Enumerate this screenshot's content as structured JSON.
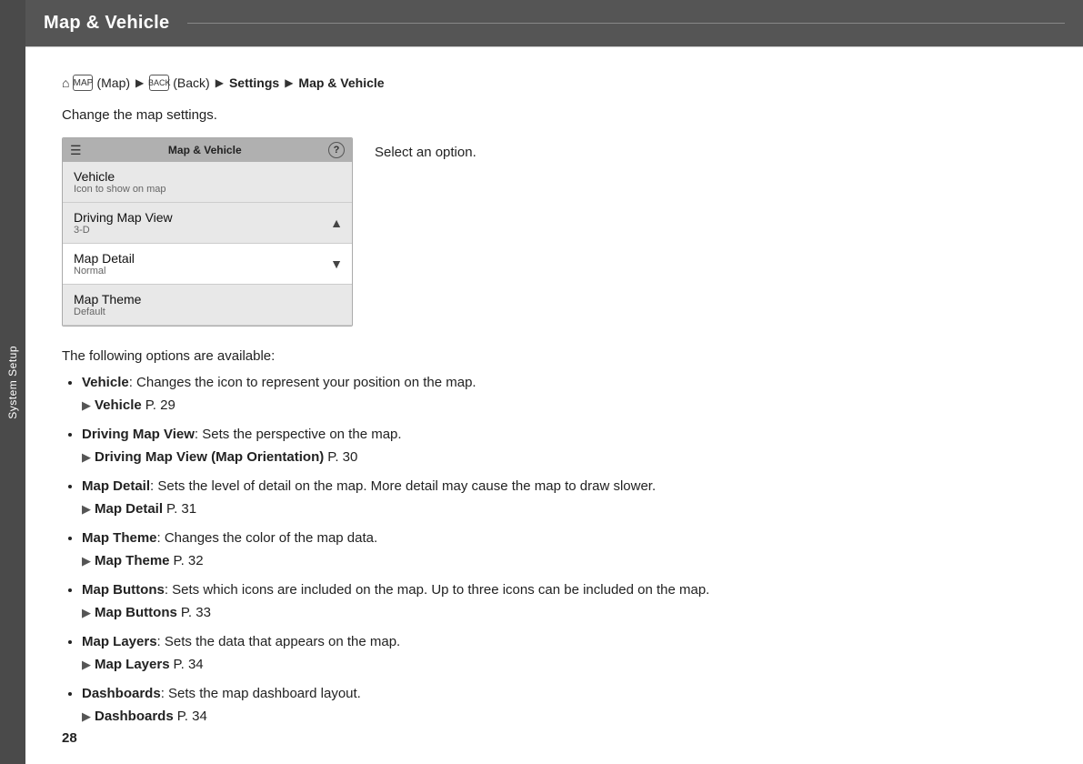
{
  "sidebar": {
    "label": "System Setup"
  },
  "header": {
    "title": "Map & Vehicle"
  },
  "breadcrumb": {
    "home_icon": "⌂",
    "map_icon": "MAP",
    "map_label": "(Map)",
    "back_icon": "BACK",
    "back_label": "(Back)",
    "arrow": "▶",
    "settings": "Settings",
    "page": "Map & Vehicle"
  },
  "intro": "Change the map settings.",
  "screenshot": {
    "header_title": "Map & Vehicle",
    "items": [
      {
        "main": "Vehicle",
        "sub": "Icon to show on map",
        "highlighted": false,
        "arrow": ""
      },
      {
        "main": "Driving Map View",
        "sub": "3-D",
        "highlighted": false,
        "arrow": "up"
      },
      {
        "main": "Map Detail",
        "sub": "Normal",
        "highlighted": true,
        "arrow": "down"
      },
      {
        "main": "Map Theme",
        "sub": "Default",
        "highlighted": false,
        "arrow": ""
      }
    ]
  },
  "caption": "Select an option.",
  "available_text": "The following options are available:",
  "options": [
    {
      "name": "Vehicle",
      "desc": ": Changes the icon to represent your position on the map.",
      "ref_text": "Vehicle",
      "ref_page": "P. 29"
    },
    {
      "name": "Driving Map View",
      "desc": ": Sets the perspective on the map.",
      "ref_text": "Driving Map View (Map Orientation)",
      "ref_page": "P. 30"
    },
    {
      "name": "Map Detail",
      "desc": ": Sets the level of detail on the map. More detail may cause the map to draw slower.",
      "ref_text": "Map Detail",
      "ref_page": "P. 31"
    },
    {
      "name": "Map Theme",
      "desc": ": Changes the color of the map data.",
      "ref_text": "Map Theme",
      "ref_page": "P. 32"
    },
    {
      "name": "Map Buttons",
      "desc": ": Sets which icons are included on the map. Up to three icons can be included on the map.",
      "ref_text": "Map Buttons",
      "ref_page": "P. 33"
    },
    {
      "name": "Map Layers",
      "desc": ": Sets the data that appears on the map.",
      "ref_text": "Map Layers",
      "ref_page": "P. 34"
    },
    {
      "name": "Dashboards",
      "desc": ": Sets the map dashboard layout.",
      "ref_text": "Dashboards",
      "ref_page": "P. 34"
    }
  ],
  "page_number": "28"
}
